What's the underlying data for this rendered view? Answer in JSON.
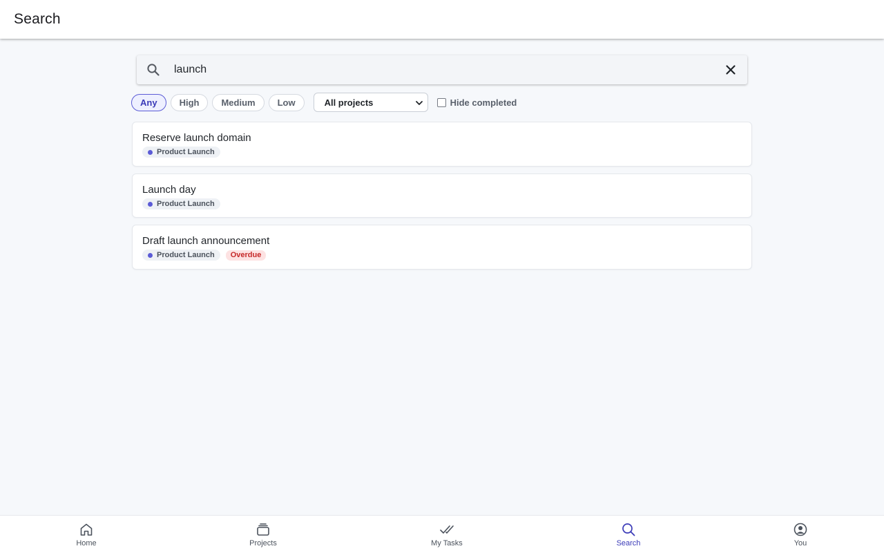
{
  "app_bar": {
    "title": "Search"
  },
  "search": {
    "value": "launch",
    "icon": "search-icon",
    "clear_icon": "close-icon"
  },
  "filters": {
    "priority_chips": [
      {
        "label": "Any",
        "active": true
      },
      {
        "label": "High",
        "active": false
      },
      {
        "label": "Medium",
        "active": false
      },
      {
        "label": "Low",
        "active": false
      }
    ],
    "project_select": {
      "selected": "All projects"
    },
    "hide_completed": {
      "label": "Hide completed",
      "checked": false
    }
  },
  "results": [
    {
      "title": "Reserve launch domain",
      "project": "Product Launch",
      "project_color": "#5b5bd6",
      "badge": ""
    },
    {
      "title": "Launch day",
      "project": "Product Launch",
      "project_color": "#5b5bd6",
      "badge": ""
    },
    {
      "title": "Draft launch announcement",
      "project": "Product Launch",
      "project_color": "#5b5bd6",
      "badge": "Overdue"
    }
  ],
  "bottom_nav": {
    "items": [
      {
        "label": "Home",
        "icon": "home-icon",
        "active": false
      },
      {
        "label": "Projects",
        "icon": "projects-icon",
        "active": false
      },
      {
        "label": "My Tasks",
        "icon": "check-icon",
        "active": false
      },
      {
        "label": "Search",
        "icon": "search-icon",
        "active": true
      },
      {
        "label": "You",
        "icon": "account-icon",
        "active": false
      }
    ]
  },
  "colors": {
    "accent": "#3b3bb8",
    "overdue": "#c62828",
    "background": "#f6f8fb"
  }
}
